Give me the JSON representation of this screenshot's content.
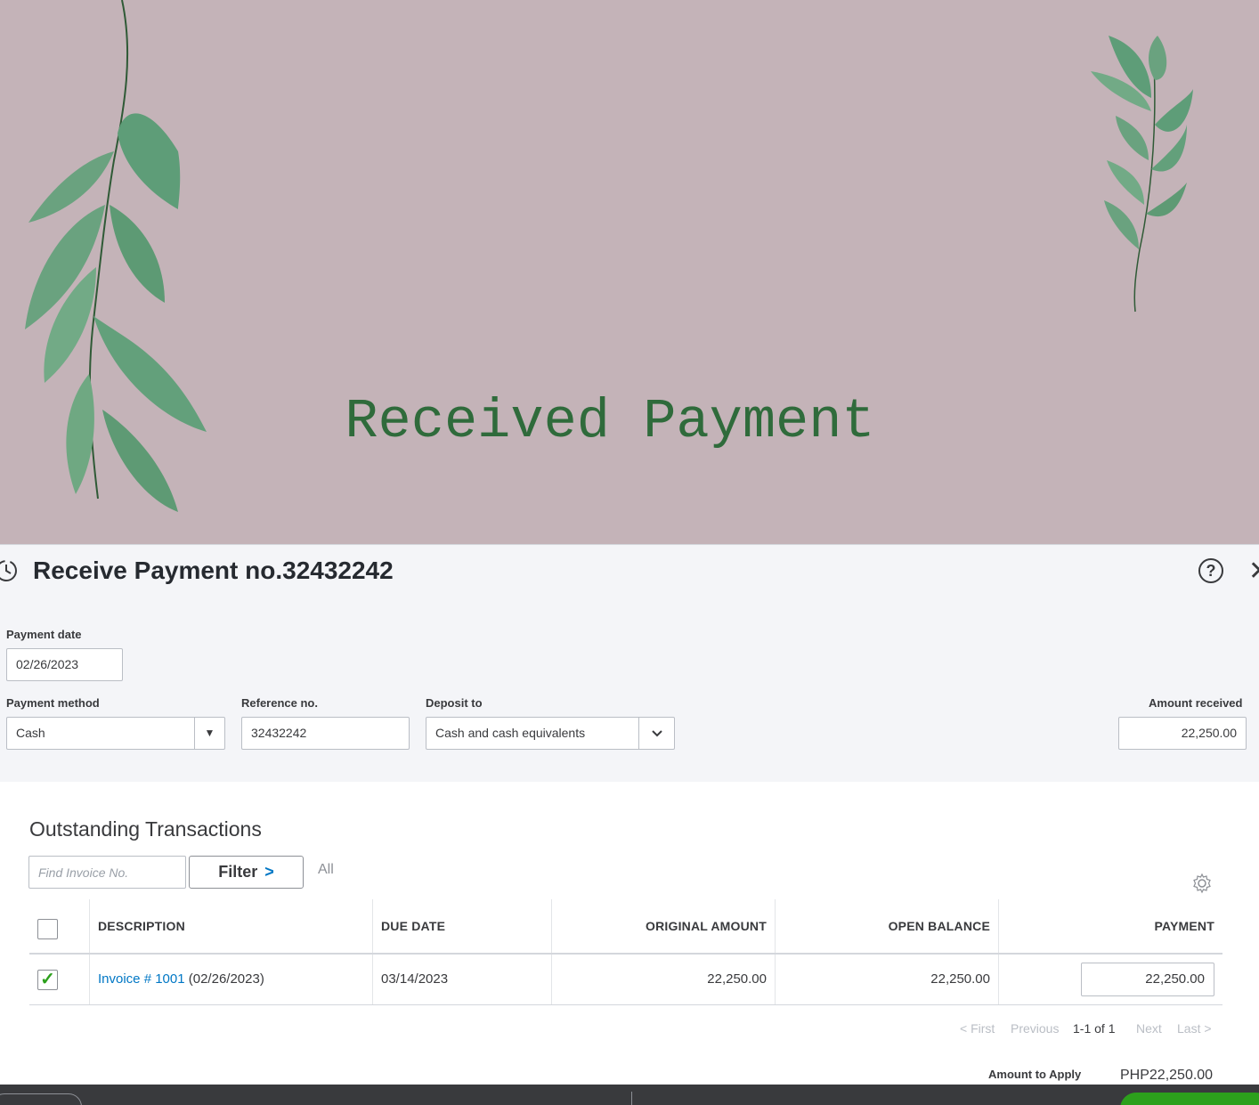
{
  "banner": {
    "title": "Received Payment"
  },
  "form": {
    "title": "Receive Payment no.32432242",
    "payment_date": {
      "label": "Payment date",
      "value": "02/26/2023"
    },
    "payment_method": {
      "label": "Payment method",
      "value": "Cash"
    },
    "reference_no": {
      "label": "Reference no.",
      "value": "32432242"
    },
    "deposit_to": {
      "label": "Deposit to",
      "value": "Cash and cash equivalents"
    },
    "amount_received": {
      "label": "Amount received",
      "value": "22,250.00"
    }
  },
  "outstanding": {
    "title": "Outstanding Transactions",
    "find_placeholder": "Find Invoice No.",
    "filter_label": "Filter",
    "filter_scope": "All",
    "columns": {
      "description": "DESCRIPTION",
      "due_date": "DUE DATE",
      "original_amount": "ORIGINAL AMOUNT",
      "open_balance": "OPEN BALANCE",
      "payment": "PAYMENT"
    },
    "rows": [
      {
        "checked": true,
        "invoice_link": "Invoice # 1001",
        "invoice_date": "(02/26/2023)",
        "due_date": "03/14/2023",
        "original_amount": "22,250.00",
        "open_balance": "22,250.00",
        "payment": "22,250.00"
      }
    ],
    "pager": {
      "first": "< First",
      "previous": "Previous",
      "range": "1-1 of 1",
      "next": "Next",
      "last": "Last >"
    },
    "amount_to_apply": {
      "label": "Amount to Apply",
      "value": "PHP22,250.00"
    }
  },
  "colors": {
    "banner_bg": "#c4b3b8",
    "banner_title": "#2f6b3b",
    "link": "#0077c5",
    "check": "#2ca01c",
    "footer_bg": "#393a3d"
  }
}
